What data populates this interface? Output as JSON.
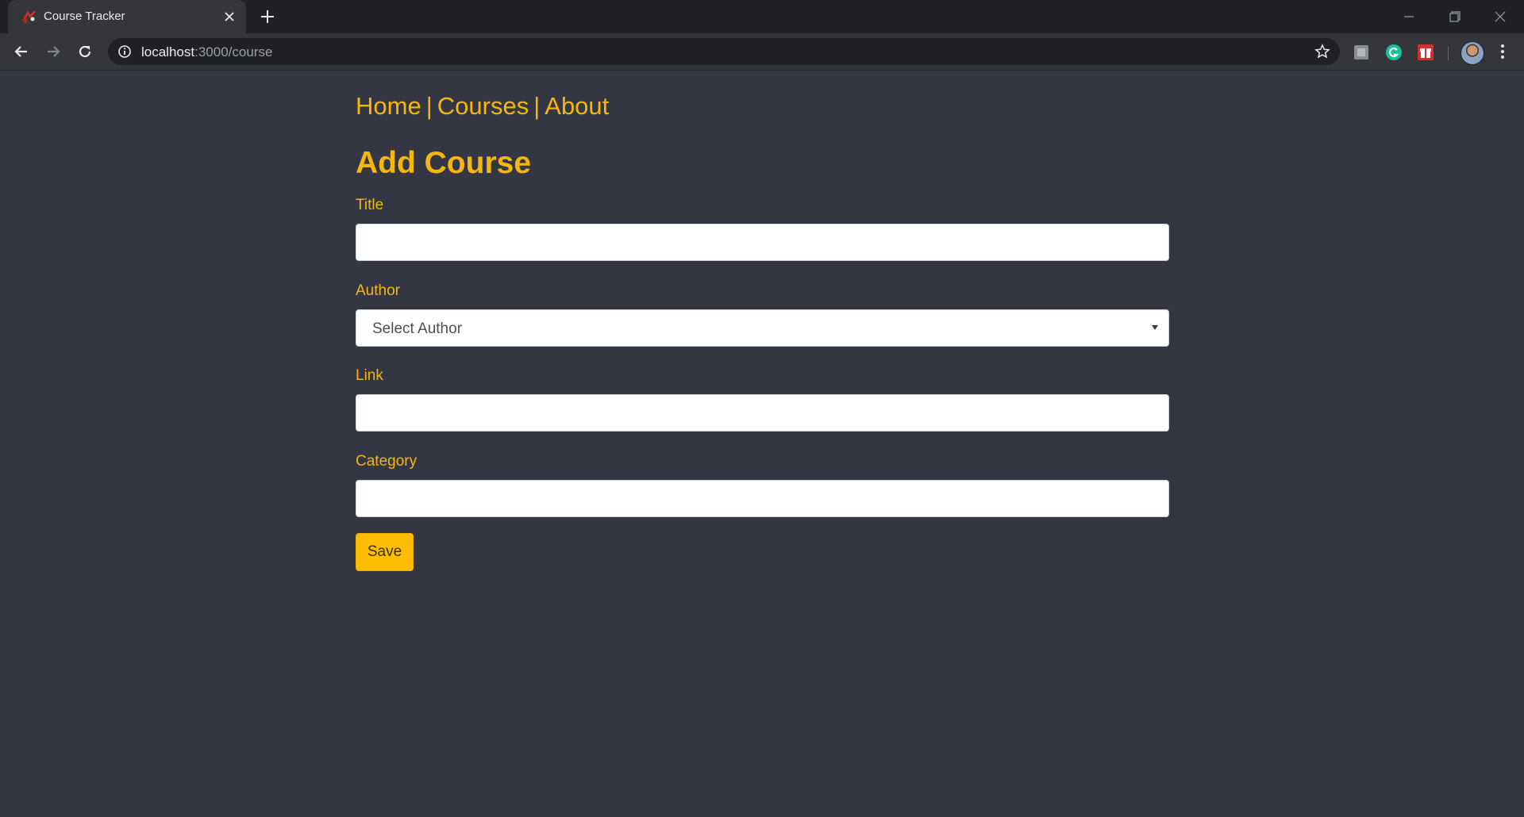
{
  "browser": {
    "tab_title": "Course Tracker",
    "url_host": "localhost",
    "url_path": ":3000/course"
  },
  "nav": {
    "links": [
      "Home",
      "Courses",
      "About"
    ],
    "separator": "|"
  },
  "page": {
    "title": "Add Course"
  },
  "form": {
    "title_label": "Title",
    "title_value": "",
    "author_label": "Author",
    "author_selected": "Select Author",
    "link_label": "Link",
    "link_value": "",
    "category_label": "Category",
    "category_value": "",
    "save_label": "Save"
  },
  "colors": {
    "page_background": "#353643",
    "accent": "#f5b70d",
    "button": "#fdbd04"
  },
  "icons": {
    "favicon": "course-tracker-favicon",
    "extensions": [
      "extension-square-icon",
      "grammarly-icon",
      "gift-icon"
    ]
  }
}
